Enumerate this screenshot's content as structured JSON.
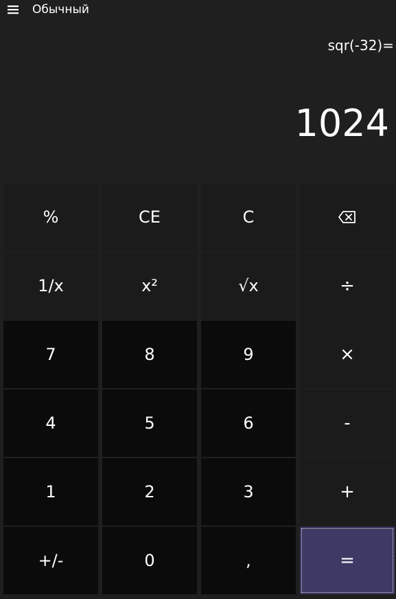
{
  "header": {
    "menu_icon": "hamburger-menu-icon",
    "mode_title": "Обычный"
  },
  "display": {
    "expression": "sqr(-32)=",
    "result": "1024"
  },
  "colors": {
    "background": "#1f1f1f",
    "function_key": "#1b1b1b",
    "digit_key": "#0b0b0b",
    "equals_key": "#3e3a66",
    "text": "#ffffff"
  },
  "keys": {
    "percent": "%",
    "clear_entry": "CE",
    "clear": "C",
    "backspace_icon": "backspace-icon",
    "reciprocal": "1/x",
    "square": "x²",
    "square_root": "√x",
    "divide": "÷",
    "seven": "7",
    "eight": "8",
    "nine": "9",
    "multiply": "×",
    "four": "4",
    "five": "5",
    "six": "6",
    "subtract": "-",
    "one": "1",
    "two": "2",
    "three": "3",
    "add": "+",
    "negate": "+/-",
    "zero": "0",
    "decimal": ",",
    "equals": "="
  }
}
